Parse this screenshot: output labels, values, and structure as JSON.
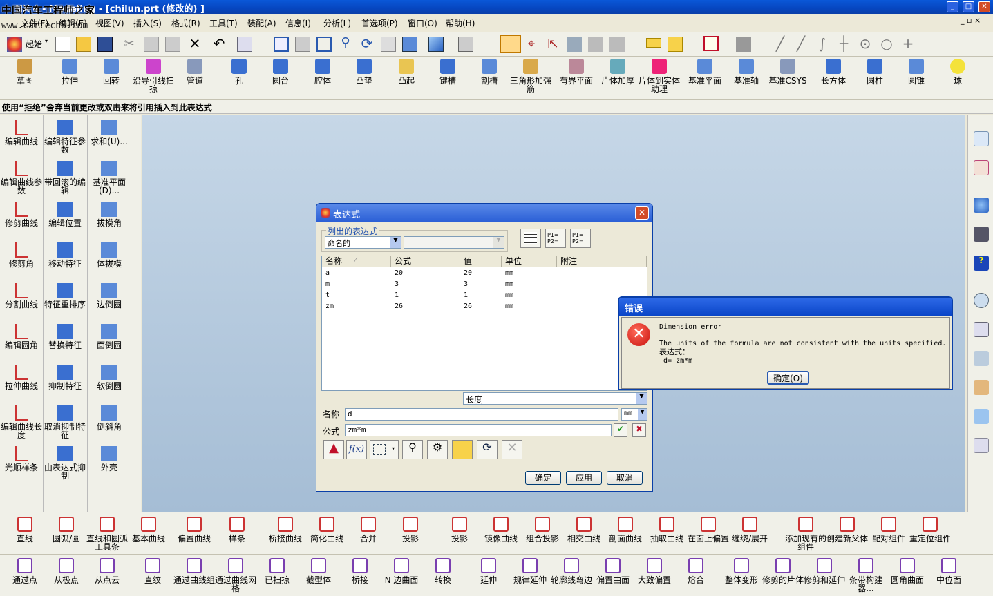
{
  "title_bar": {
    "text": "NX 4 - Modeling - [chilun.prt  (修改的) ]",
    "watermark": "中国汽车工程师之家"
  },
  "menubar": {
    "watermark": "www.cartech8.com",
    "items": [
      "文件(F)",
      "编辑(E)",
      "视图(V)",
      "插入(S)",
      "格式(R)",
      "工具(T)",
      "装配(A)",
      "信息(I)",
      "分析(L)",
      "首选项(P)",
      "窗口(O)",
      "帮助(H)"
    ]
  },
  "std_toolbar": {
    "start_label": "起始"
  },
  "feature_toolbar": [
    "草图",
    "拉伸",
    "回转",
    "沿导引线扫掠",
    "管道",
    "孔",
    "圆台",
    "腔体",
    "凸垫",
    "凸起",
    "键槽",
    "割槽",
    "三角形加强筋",
    "有界平面",
    "片体加厚",
    "片体到实体助理",
    "基准平面",
    "基准轴",
    "基准CSYS",
    "长方体",
    "圆柱",
    "圆锥",
    "球"
  ],
  "status_message": "使用“拒绝”舍弃当前更改或双击来将引用插入到此表达式",
  "left_col1": [
    "编辑曲线",
    "编辑曲线参数",
    "修剪曲线",
    "修剪角",
    "分割曲线",
    "编辑圆角",
    "拉伸曲线",
    "编辑曲线长度",
    "光顺样条"
  ],
  "left_col2": [
    "编辑特征参数",
    "带回滚的编辑",
    "编辑位置",
    "移动特征",
    "特征重排序",
    "替换特征",
    "抑制特征",
    "取消抑制特征",
    "由表达式抑制"
  ],
  "left_col3": [
    "求和(U)...",
    "基准平面(D)...",
    "拔模角",
    "体拔模",
    "边倒圆",
    "面倒圆",
    "软倒圆",
    "倒斜角",
    "外壳"
  ],
  "bottom_row1": [
    "直线",
    "圆弧/圆",
    "直线和圆弧工具条",
    "基本曲线",
    "偏置曲线",
    "样条",
    "桥接曲线",
    "简化曲线",
    "合并",
    "投影",
    "投影",
    "镜像曲线",
    "组合投影",
    "相交曲线",
    "剖面曲线",
    "抽取曲线",
    "在面上偏置",
    "缠绕/展开",
    "添加现有的组件",
    "创建新父体",
    "配对组件",
    "重定位组件"
  ],
  "bottom_row2": [
    "通过点",
    "从极点",
    "从点云",
    "直纹",
    "通过曲线组",
    "通过曲线网格",
    "已扫掠",
    "截型体",
    "桥接",
    "N 边曲面",
    "转换",
    "延伸",
    "规律延伸",
    "轮廓线弯边",
    "偏置曲面",
    "大致偏置",
    "熔合",
    "整体变形",
    "修剪的片体",
    "修剪和延伸",
    "条带构建器...",
    "圆角曲面",
    "中位面"
  ],
  "expr_dialog": {
    "title": "表达式",
    "group_label": "列出的表达式",
    "list_filter": "命名的",
    "columns": [
      "名称",
      "公式",
      "值",
      "单位",
      "附注"
    ],
    "rows": [
      {
        "name": "a",
        "formula": "20",
        "value": "20",
        "unit": "mm"
      },
      {
        "name": "m",
        "formula": "3",
        "value": "3",
        "unit": "mm"
      },
      {
        "name": "t",
        "formula": "1",
        "value": "1",
        "unit": "mm"
      },
      {
        "name": "zm",
        "formula": "26",
        "value": "26",
        "unit": "mm"
      }
    ],
    "type_select": "长度",
    "name_label": "名称",
    "name_value": "d",
    "unit_select": "mm",
    "formula_label": "公式",
    "formula_value": "zm*m",
    "ok": "确定",
    "apply": "应用",
    "cancel": "取消"
  },
  "error_dialog": {
    "title": "错误",
    "line1": "Dimension error",
    "line2": "The units of the formula are not consistent with the units specified.",
    "line3": "表达式：",
    "line4": "d= zm*m",
    "ok": "确定(O)"
  }
}
